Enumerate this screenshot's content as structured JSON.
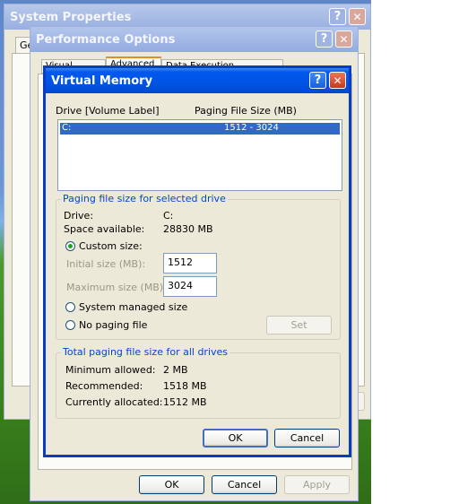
{
  "system_properties": {
    "title": "System Properties",
    "tab_partial": "Ge"
  },
  "performance_options": {
    "title": "Performance Options",
    "tabs": [
      "Visual Effects",
      "Advanced",
      "Data Execution Prevention"
    ],
    "buttons": {
      "ok": "OK",
      "cancel": "Cancel",
      "apply": "Apply"
    }
  },
  "virtual_memory": {
    "title": "Virtual Memory",
    "list": {
      "header_drive": "Drive  [Volume Label]",
      "header_size": "Paging File Size (MB)",
      "rows": [
        {
          "drive": "C:",
          "size": "1512 - 3024"
        }
      ]
    },
    "selected_drive_group": {
      "title": "Paging file size for selected drive",
      "drive_label": "Drive:",
      "drive_value": "C:",
      "space_label": "Space available:",
      "space_value": "28830 MB",
      "custom_size_label": "Custom size:",
      "initial_label": "Initial size (MB):",
      "initial_value": "1512",
      "maximum_label": "Maximum size (MB):",
      "maximum_value": "3024",
      "system_managed_label": "System managed size",
      "no_paging_label": "No paging file",
      "set_button": "Set",
      "selected_option": "Custom size:"
    },
    "total_group": {
      "title": "Total paging file size for all drives",
      "min_label": "Minimum allowed:",
      "min_value": "2 MB",
      "rec_label": "Recommended:",
      "rec_value": "1518 MB",
      "cur_label": "Currently allocated:",
      "cur_value": "1512 MB"
    },
    "buttons": {
      "ok": "OK",
      "cancel": "Cancel"
    }
  },
  "colors": {
    "title_active": "#0054e3",
    "selection": "#316ac5",
    "group_title": "#0046d5",
    "dialog_bg": "#ece9d8"
  }
}
